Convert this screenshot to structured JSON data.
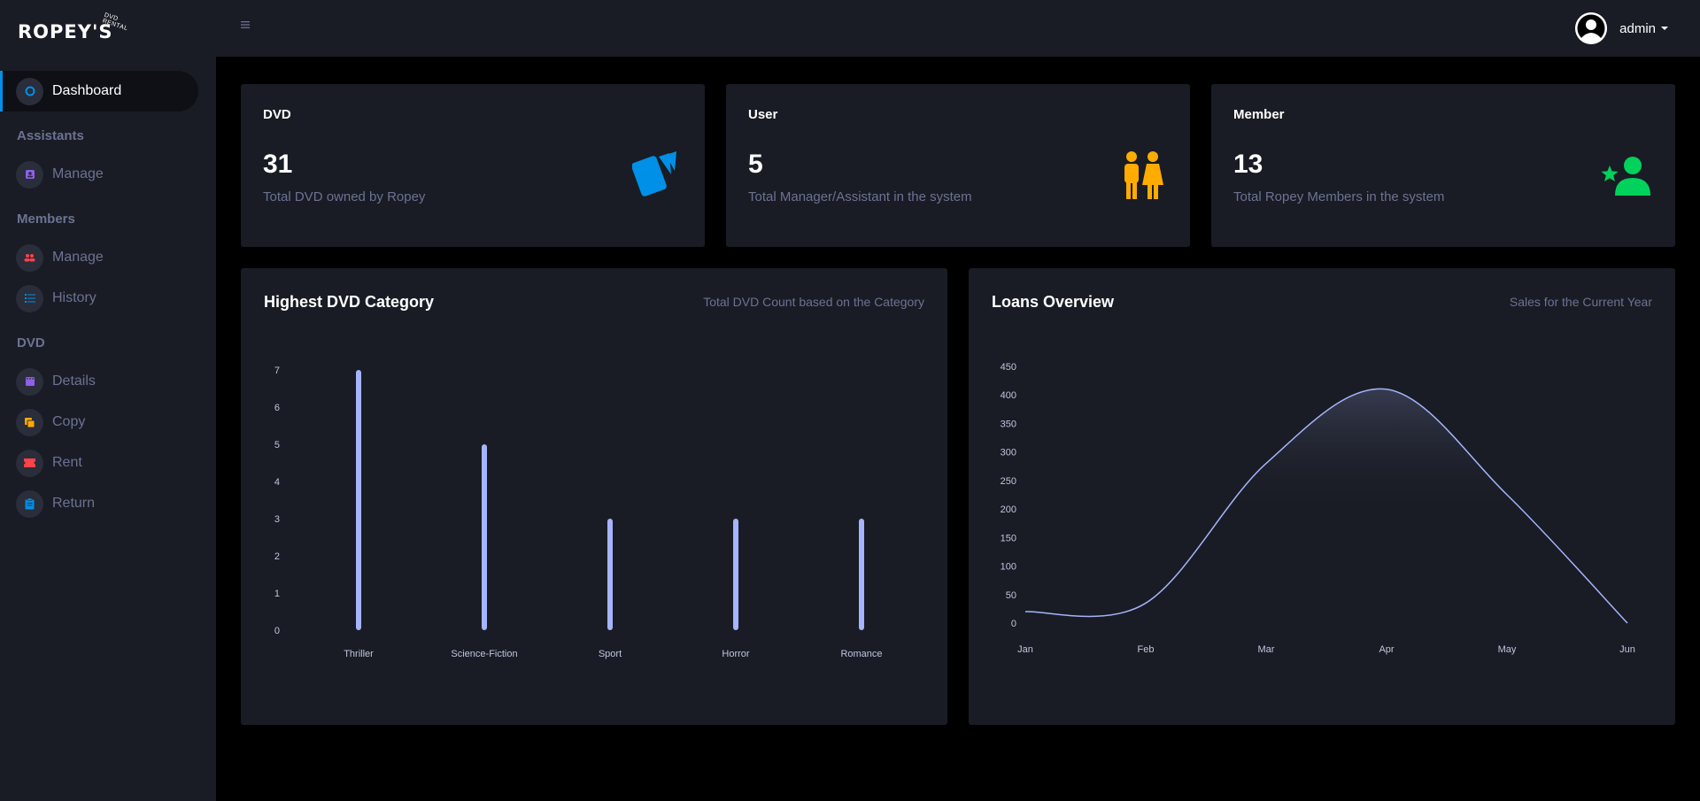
{
  "brand": {
    "name": "ROPEY'S",
    "sub": "DVD RENTAL"
  },
  "sidebar": {
    "dashboard": "Dashboard",
    "sections": {
      "assistants": "Assistants",
      "members": "Members",
      "dvd": "DVD"
    },
    "items": {
      "assistants_manage": "Manage",
      "members_manage": "Manage",
      "members_history": "History",
      "dvd_details": "Details",
      "dvd_copy": "Copy",
      "dvd_rent": "Rent",
      "dvd_return": "Return"
    }
  },
  "topbar": {
    "user": "admin"
  },
  "stats": [
    {
      "title": "DVD",
      "value": "31",
      "desc": "Total DVD owned by Ropey",
      "icon": "dvd-cards-icon",
      "color": "#0090e7"
    },
    {
      "title": "User",
      "value": "5",
      "desc": "Total Manager/Assistant in the system",
      "icon": "people-icon",
      "color": "#ffab00"
    },
    {
      "title": "Member",
      "value": "13",
      "desc": "Total Ropey Members in the system",
      "icon": "member-star-icon",
      "color": "#00d25b"
    }
  ],
  "panels": {
    "category": {
      "title": "Highest DVD Category",
      "sub": "Total DVD Count based on the Category"
    },
    "loans": {
      "title": "Loans Overview",
      "sub": "Sales for the Current Year"
    }
  },
  "chart_data": [
    {
      "type": "bar",
      "categories": [
        "Thriller",
        "Science-Fiction",
        "Sport",
        "Horror",
        "Romance"
      ],
      "values": [
        7,
        5,
        3,
        3,
        3
      ],
      "ylim": [
        0,
        7
      ],
      "yticks": [
        0,
        1,
        2,
        3,
        4,
        5,
        6,
        7
      ],
      "grid": false,
      "legend": "none"
    },
    {
      "type": "area",
      "x": [
        "Jan",
        "Feb",
        "Mar",
        "Apr",
        "May",
        "Jun"
      ],
      "values": [
        20,
        35,
        280,
        410,
        225,
        0
      ],
      "ylim": [
        0,
        450
      ],
      "yticks": [
        0,
        50,
        100,
        150,
        200,
        250,
        300,
        350,
        400,
        450
      ],
      "grid": false,
      "legend": "none"
    }
  ],
  "colors": {
    "bar": "#a5b4fc",
    "line": "#a5b4fc",
    "sidebar": "#191c24",
    "bg": "#000000"
  }
}
